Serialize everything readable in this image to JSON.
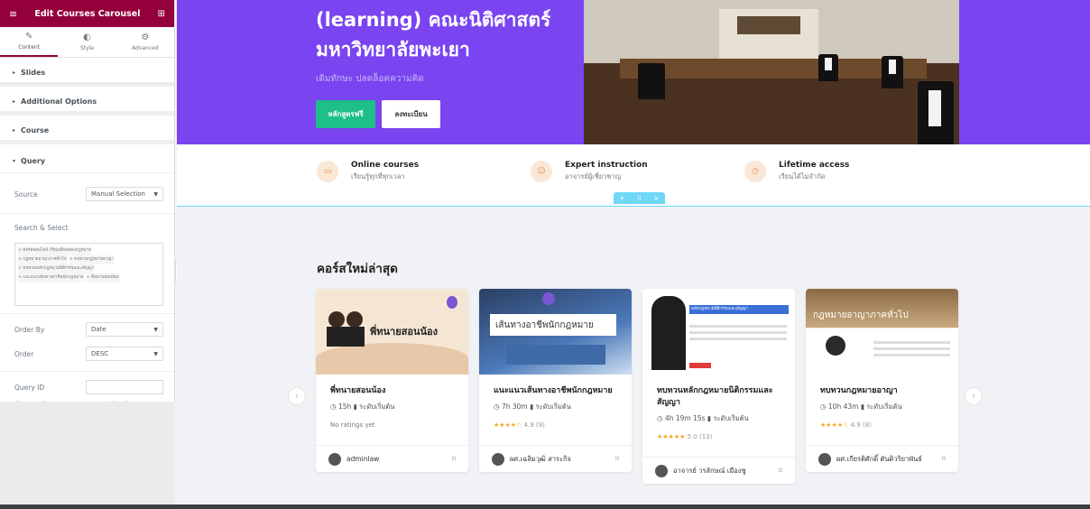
{
  "panel": {
    "title": "Edit Courses Carousel",
    "tabs": [
      {
        "label": "Content",
        "icon": "pencil-icon"
      },
      {
        "label": "Style",
        "icon": "contrast-icon"
      },
      {
        "label": "Advanced",
        "icon": "gear-icon"
      }
    ],
    "sections": [
      "Slides",
      "Additional Options",
      "Course",
      "Query"
    ],
    "source_label": "Source",
    "source_value": "Manual Selection",
    "search_label": "Search & Select",
    "tags": [
      "× คอร์สออนไลน์ เรียนเขียนสอบกฎหมาย",
      "× กฎหมายอาญาภาคทั่วไป",
      "× ทบทวนกฎหมายอาญา",
      "× ทบทวนหลักกฎหมายนิติกรรมและสัญญา",
      "× แนะแนวเส้นทางอาชีพนักกฎหมาย",
      "× พี่ทนายสอนน้อง"
    ],
    "order_by_label": "Order By",
    "order_by_value": "Date",
    "order_label": "Order",
    "order_value": "DESC",
    "query_id_label": "Query ID",
    "query_hint": "Give your Query a custom unique id to allow server side filtering"
  },
  "hero": {
    "title_line1": "(learning) คณะนิติศาสตร์",
    "title_line2": "มหาวิทยาลัยพะเยา",
    "subtitle": "เติมทักษะ ปลดล็อคความคิด",
    "btn_free": "หลักสูตรฟรี",
    "btn_register": "ลงทะเบียน"
  },
  "features": [
    {
      "title": "Online courses",
      "sub": "เรียนรู้ทุกที่ทุกเวลา",
      "icon": "video-icon"
    },
    {
      "title": "Expert instruction",
      "sub": "อาจารย์ผู้เชี่ยวชาญ",
      "icon": "users-icon"
    },
    {
      "title": "Lifetime access",
      "sub": "เรียนได้ไม่จำกัด",
      "icon": "clock-icon"
    }
  ],
  "section_bar": [
    "+",
    "⠿",
    "×"
  ],
  "latest_title": "คอร์สใหม่ล่าสุด",
  "courses": [
    {
      "thumb_text": "พี่ทนายสอนน้อง",
      "title": "พี่ทนายสอนน้อง",
      "duration": "15h",
      "level": "ระดับเริ่มต้น",
      "rating_stars": "",
      "rating_value": "",
      "no_ratings": "No ratings yet",
      "author": "adminlaw"
    },
    {
      "thumb_text": "เส้นทางอาชีพนักกฎหมาย",
      "title": "แนะแนวเส้นทางอาชีพนักกฎหมาย",
      "duration": "7h 30m",
      "level": "ระดับเริ่มต้น",
      "rating_stars": "★★★★☆",
      "rating_value": "4.9 (9)",
      "no_ratings": "",
      "author": "ผศ.เฉลิมวุฒิ สาระกิจ"
    },
    {
      "thumb_text": "หลักกฎหมายนิติกรรมและสัญญา",
      "title": "ทบทวนหลักกฎหมายนิติกรรมและสัญญา",
      "duration": "4h 19m 15s",
      "level": "ระดับเริ่มต้น",
      "rating_stars": "★★★★★",
      "rating_value": "5.0 (13)",
      "no_ratings": "",
      "author": "อาจารย์ วรลักษณ์ เมืองชู"
    },
    {
      "thumb_text": "กฎหมายอาญาภาคทั่วไป",
      "title": "ทบทวนกฎหมายอาญา",
      "duration": "10h 43m",
      "level": "ระดับเริ่มต้น",
      "rating_stars": "★★★★☆",
      "rating_value": "4.9 (8)",
      "no_ratings": "",
      "author": "ผศ.เกียรติศักดิ์ ตันติวริยาพันธ์"
    }
  ]
}
